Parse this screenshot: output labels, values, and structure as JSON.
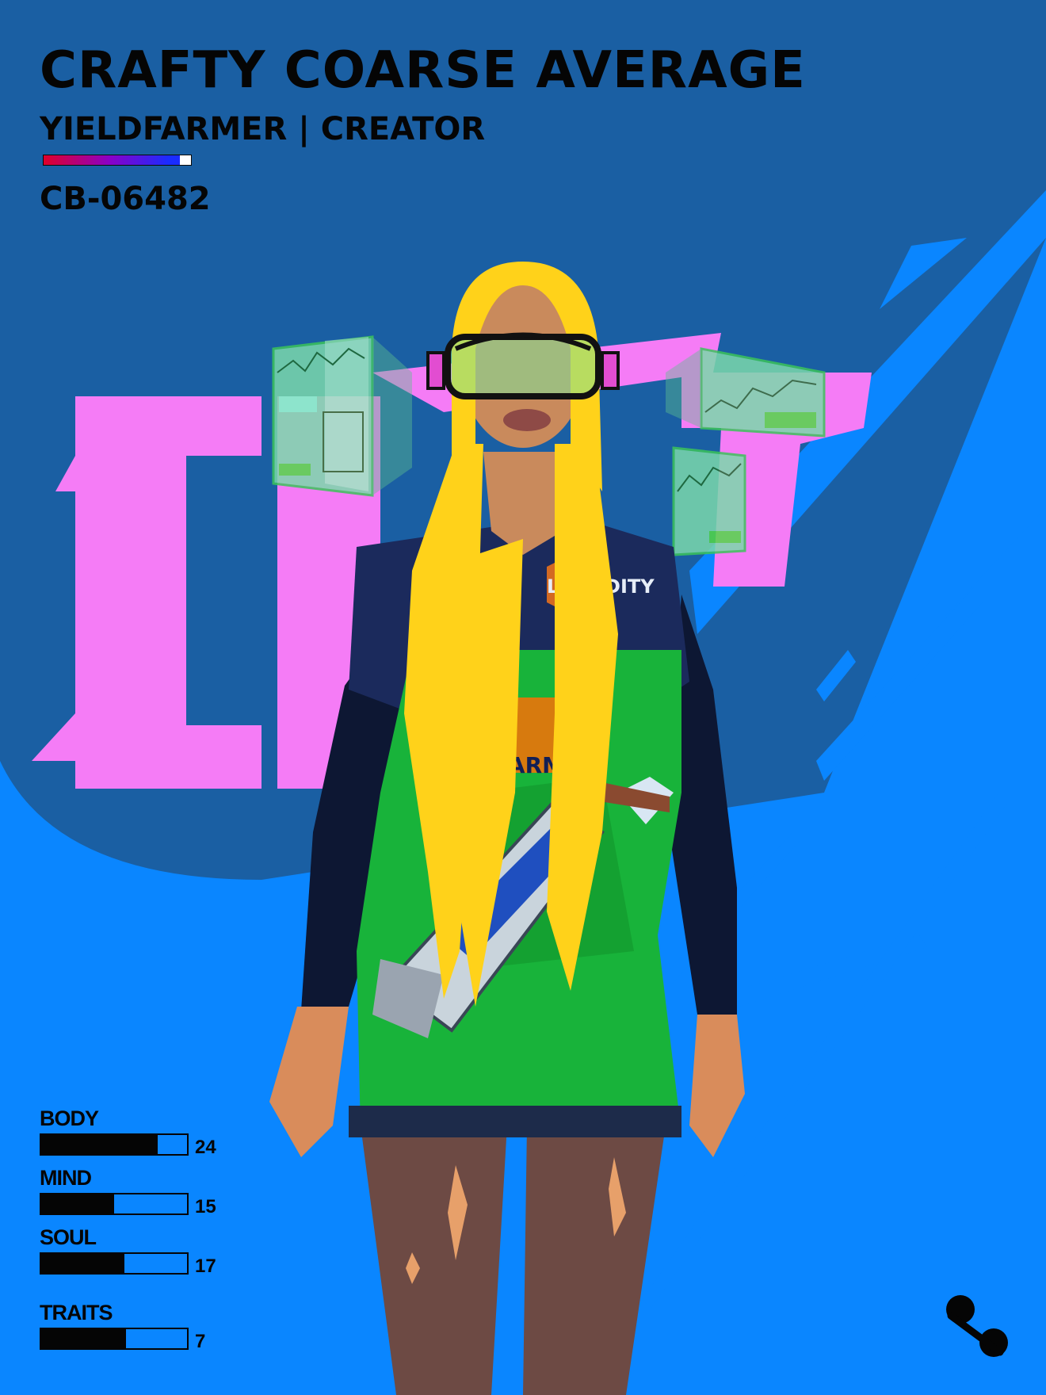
{
  "card": {
    "name": "CRAFTY COARSE AVERAGE",
    "role": "YIELDFARMER | CREATOR",
    "id": "CB-06482",
    "shirt_text": "LIQUIDITY",
    "apron_text": "FARM"
  },
  "stats": [
    {
      "label": "BODY",
      "value": "24",
      "fill": 0.8
    },
    {
      "label": "MIND",
      "value": "15",
      "fill": 0.5
    },
    {
      "label": "SOUL",
      "value": "17",
      "fill": 0.57
    },
    {
      "label": "TRAITS",
      "value": "7",
      "fill": 0.58
    }
  ],
  "icons": {
    "corner": "percent-icon",
    "eyewear": "visor-goggles-icon",
    "screens": "hologram-chart-screen-icon"
  },
  "colors": {
    "background": "#1a5fa3",
    "accent_blue": "#0a86ff",
    "accent_pink": "#f57cf6",
    "hair": "#ffd21a",
    "overalls": "#18b33a",
    "text": "#050505"
  }
}
